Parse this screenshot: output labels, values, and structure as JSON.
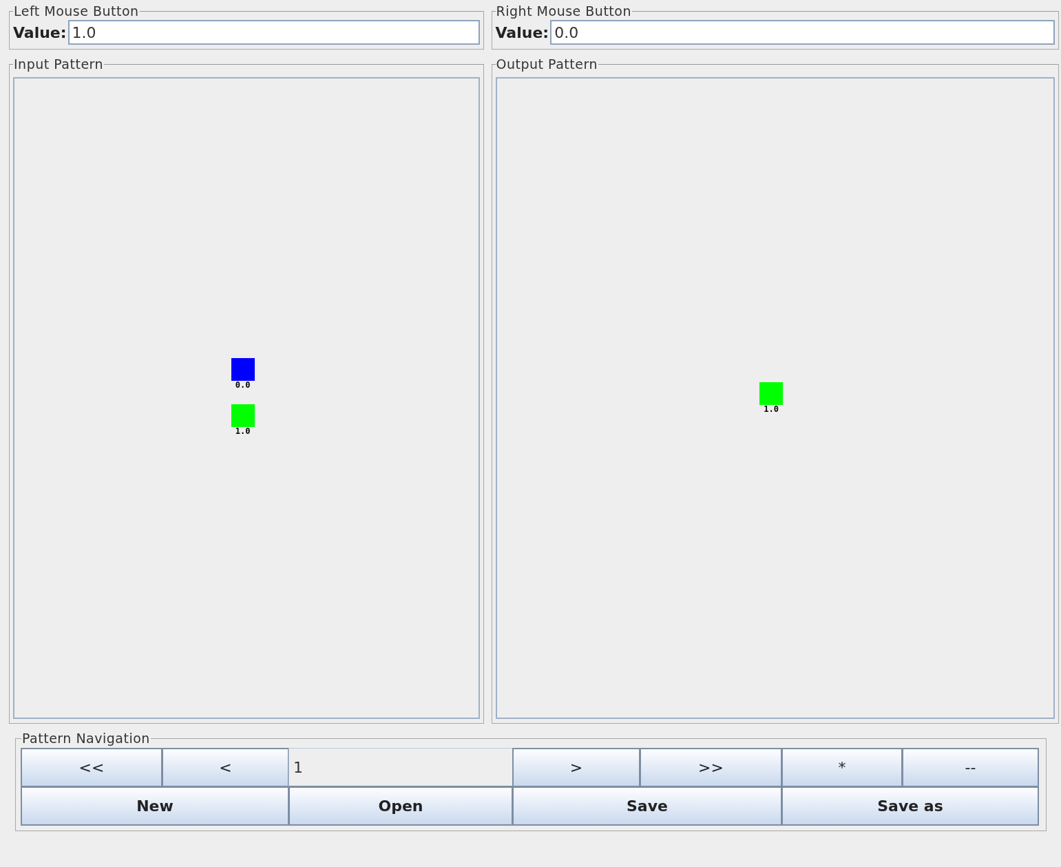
{
  "left_mouse_button": {
    "title": "Left Mouse Button",
    "label": "Value:",
    "value": "1.0"
  },
  "right_mouse_button": {
    "title": "Right Mouse Button",
    "label": "Value:",
    "value": "0.0"
  },
  "input_pattern": {
    "title": "Input Pattern",
    "nodes": [
      {
        "label": "0.0",
        "color": "#0000ff"
      },
      {
        "label": "1.0",
        "color": "#00ff00"
      }
    ]
  },
  "output_pattern": {
    "title": "Output Pattern",
    "nodes": [
      {
        "label": "1.0",
        "color": "#00ff00"
      }
    ]
  },
  "pattern_navigation": {
    "title": "Pattern Navigation",
    "nav_buttons": [
      "<<",
      "<"
    ],
    "pattern_index": "1",
    "nav_buttons_right": [
      ">",
      ">>",
      "*",
      "--"
    ],
    "file_buttons": [
      "New",
      "Open",
      "Save",
      "Save as"
    ]
  }
}
